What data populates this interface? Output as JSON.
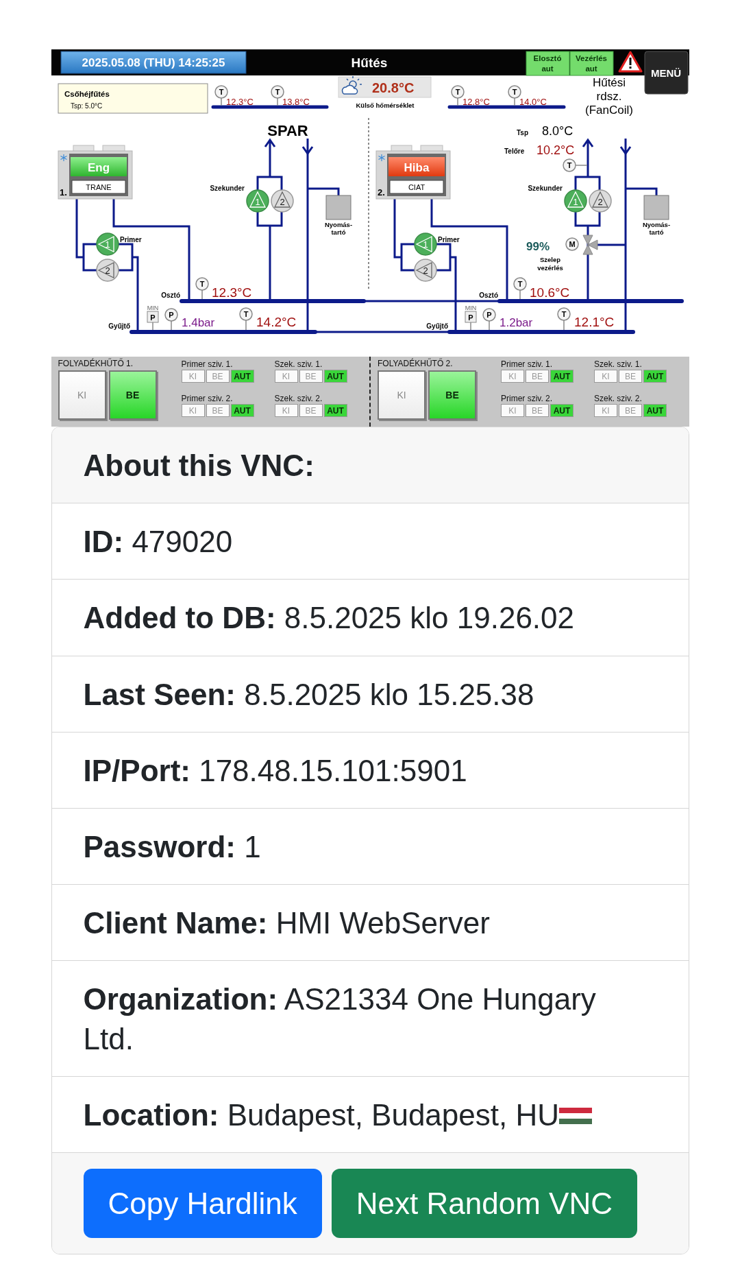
{
  "hmi": {
    "header": {
      "datetime": "2025.05.08 (THU) 14:25:25",
      "title": "Hűtés",
      "modes": [
        {
          "label": "Elosztó",
          "state": "aut"
        },
        {
          "label": "Vezérlés",
          "state": "aut"
        }
      ],
      "menu": "MENÜ"
    },
    "schematic": {
      "pipe_heating": {
        "title": "Csőhéjfűtés",
        "setpoint": "Tsp: 5.0°C"
      },
      "outdoor": {
        "temperature": "20.8°C",
        "label": "Külső hőmérséklet"
      },
      "circuits": [
        {
          "load": [
            "SPAR"
          ],
          "top_sensors": [
            {
              "symbol": "T",
              "reading": "12.3°C"
            },
            {
              "symbol": "T",
              "reading": "13.8°C"
            }
          ],
          "chiller": {
            "number": "1.",
            "brand": "TRANE",
            "status": "Eng",
            "fault": false
          },
          "primer": {
            "label": "Primer",
            "pumps": [
              {
                "number": "1",
                "running": true
              },
              {
                "number": "2",
                "running": false
              }
            ]
          },
          "secondary": {
            "label": "Szekunder",
            "pumps": [
              {
                "number": "1",
                "running": true
              },
              {
                "number": "2",
                "running": false
              }
            ]
          },
          "tank": [
            "Nyomás-",
            "tartó"
          ],
          "supply": {
            "label": "Osztó",
            "symbol": "T",
            "temperature": "12.3°C"
          },
          "return": {
            "label": "Gyűjtő",
            "min_tag": "MIN",
            "min_symbol": "P",
            "pressure_symbol": "P",
            "pressure": "1.4bar",
            "temp_symbol": "T",
            "temperature": "14.2°C"
          }
        },
        {
          "load": [
            "Hűtési",
            "rdsz.",
            "(FanCoil)"
          ],
          "top_sensors": [
            {
              "symbol": "T",
              "reading": "12.8°C"
            },
            {
              "symbol": "T",
              "reading": "14.0°C"
            }
          ],
          "chiller": {
            "number": "2.",
            "brand": "CIAT",
            "status": "Hiba",
            "fault": true
          },
          "primer": {
            "label": "Primer",
            "pumps": [
              {
                "number": "1",
                "running": true
              },
              {
                "number": "2",
                "running": false
              }
            ]
          },
          "secondary": {
            "label": "Szekunder",
            "pumps": [
              {
                "number": "1",
                "running": true
              },
              {
                "number": "2",
                "running": false
              }
            ]
          },
          "tank": [
            "Nyomás-",
            "tartó"
          ],
          "supply": {
            "label": "Osztó",
            "symbol": "T",
            "temperature": "10.6°C"
          },
          "return": {
            "label": "Gyűjtő",
            "min_tag": "MIN",
            "min_symbol": "P",
            "pressure_symbol": "P",
            "pressure": "1.2bar",
            "temp_symbol": "T",
            "temperature": "12.1°C"
          },
          "setpoint": {
            "label": "Tsp",
            "value": "8.0°C"
          },
          "flow": {
            "label": "Telőre",
            "value": "10.2°C",
            "symbol": "T"
          },
          "valve": {
            "symbol": "M",
            "opening": "99%",
            "label": [
              "Szelep",
              "vezérlés"
            ]
          }
        }
      ]
    },
    "controls": [
      {
        "title": "FOLYADÉKHŰTŐ 1.",
        "main": [
          {
            "label": "KI",
            "selected": false
          },
          {
            "label": "BE",
            "selected": true
          }
        ],
        "selectors": [
          {
            "title": "Primer sziv. 1.",
            "options": [
              {
                "label": "KI",
                "selected": false
              },
              {
                "label": "BE",
                "selected": false
              },
              {
                "label": "AUT",
                "selected": true
              }
            ]
          },
          {
            "title": "Primer sziv. 2.",
            "options": [
              {
                "label": "KI",
                "selected": false
              },
              {
                "label": "BE",
                "selected": false
              },
              {
                "label": "AUT",
                "selected": true
              }
            ]
          },
          {
            "title": "Szek. sziv. 1.",
            "options": [
              {
                "label": "KI",
                "selected": false
              },
              {
                "label": "BE",
                "selected": false
              },
              {
                "label": "AUT",
                "selected": true
              }
            ]
          },
          {
            "title": "Szek. sziv. 2.",
            "options": [
              {
                "label": "KI",
                "selected": false
              },
              {
                "label": "BE",
                "selected": false
              },
              {
                "label": "AUT",
                "selected": true
              }
            ]
          }
        ]
      },
      {
        "title": "FOLYADÉKHŰTŐ 2.",
        "main": [
          {
            "label": "KI",
            "selected": false
          },
          {
            "label": "BE",
            "selected": true
          }
        ],
        "selectors": [
          {
            "title": "Primer sziv. 1.",
            "options": [
              {
                "label": "KI",
                "selected": false
              },
              {
                "label": "BE",
                "selected": false
              },
              {
                "label": "AUT",
                "selected": true
              }
            ]
          },
          {
            "title": "Primer sziv. 2.",
            "options": [
              {
                "label": "KI",
                "selected": false
              },
              {
                "label": "BE",
                "selected": false
              },
              {
                "label": "AUT",
                "selected": true
              }
            ]
          },
          {
            "title": "Szek. sziv. 1.",
            "options": [
              {
                "label": "KI",
                "selected": false
              },
              {
                "label": "BE",
                "selected": false
              },
              {
                "label": "AUT",
                "selected": true
              }
            ]
          },
          {
            "title": "Szek. sziv. 2.",
            "options": [
              {
                "label": "KI",
                "selected": false
              },
              {
                "label": "BE",
                "selected": false
              },
              {
                "label": "AUT",
                "selected": true
              }
            ]
          }
        ]
      }
    ]
  },
  "vnc": {
    "title": "About this VNC:",
    "rows": [
      {
        "kind": "text",
        "label": "ID:",
        "value": "479020"
      },
      {
        "kind": "text",
        "label": "Added to DB:",
        "value": "8.5.2025 klo 19.26.02"
      },
      {
        "kind": "text",
        "label": "Last Seen:",
        "value": "8.5.2025 klo 15.25.38"
      },
      {
        "kind": "text",
        "label": "IP/Port:",
        "value": "178.48.15.101:5901"
      },
      {
        "kind": "text",
        "label": "Password:",
        "value": "1"
      },
      {
        "kind": "text",
        "label": "Client Name:",
        "value": "HMI WebServer"
      },
      {
        "kind": "text",
        "label": "Organization:",
        "value": "AS21334 One Hungary Ltd."
      },
      {
        "kind": "location",
        "label": "Location:",
        "value": "Budapest, Budapest, HU"
      }
    ],
    "buttons": [
      {
        "label": "Copy Hardlink",
        "kind": "primary"
      },
      {
        "label": "Next Random VNC",
        "kind": "success"
      }
    ]
  }
}
